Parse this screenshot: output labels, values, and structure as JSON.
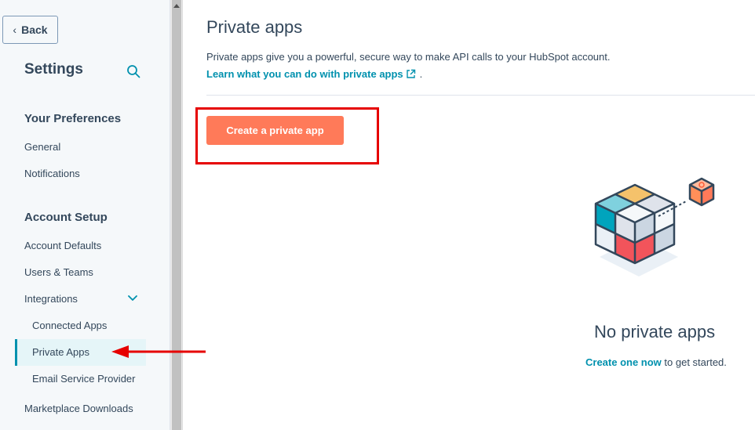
{
  "sidebar": {
    "back_label": "Back",
    "title": "Settings",
    "sections": [
      {
        "heading": "Your Preferences",
        "items": [
          "General",
          "Notifications"
        ]
      },
      {
        "heading": "Account Setup",
        "items": [
          "Account Defaults",
          "Users & Teams",
          "Integrations"
        ]
      }
    ],
    "integrations_sub": [
      "Connected Apps",
      "Private Apps",
      "Email Service Provider"
    ],
    "active_item": "Private Apps",
    "after_item": "Marketplace Downloads"
  },
  "main": {
    "title": "Private apps",
    "description": "Private apps give you a powerful, secure way to make API calls to your HubSpot account.",
    "learn_link": "Learn what you can do with private apps",
    "learn_suffix": ".",
    "create_button": "Create a private app",
    "empty_title": "No private apps",
    "empty_link": "Create one now",
    "empty_suffix": " to get started."
  },
  "colors": {
    "accent_orange": "#ff7a59",
    "link_teal": "#0091ae",
    "annotation_red": "#e60000"
  }
}
